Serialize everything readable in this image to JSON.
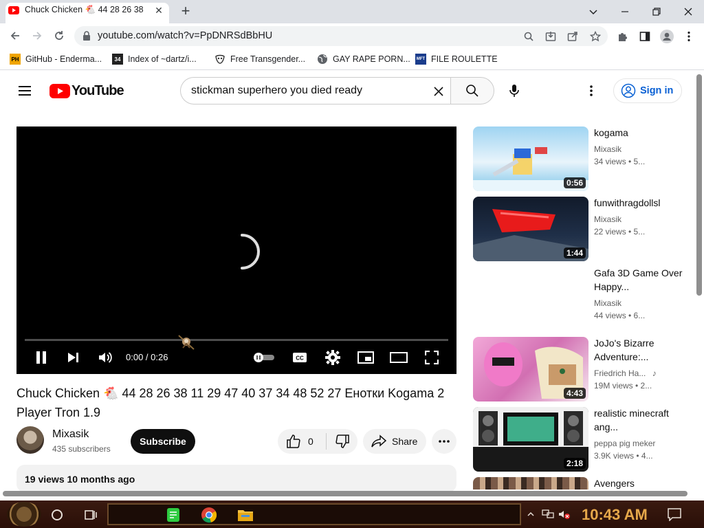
{
  "browser": {
    "tab_title": "Chuck Chicken 🐔 44 28 26 38",
    "url": "youtube.com/watch?v=PpDNRSdBbHU",
    "bookmarks": [
      {
        "label": "GitHub - Enderma...",
        "icon": "PH"
      },
      {
        "label": "Index of ~dartz/i...",
        "icon": "34"
      },
      {
        "label": "Free Transgender...",
        "icon": "mask"
      },
      {
        "label": "GAY RAPE PORN...",
        "icon": "globe"
      },
      {
        "label": "FILE ROULETTE",
        "icon": "MFT"
      }
    ]
  },
  "youtube": {
    "logo_text": "YouTube",
    "search_query": "stickman superhero you died ready",
    "signin_label": "Sign in"
  },
  "player": {
    "time": "0:00 / 0:26"
  },
  "video": {
    "title": "Chuck Chicken 🐔 44 28 26 38 11 29 47 40 37 34 48 52 27 Енотки Kogama 2 Player Tron 1.9",
    "channel": "Mixasik",
    "subscribers": "435 subscribers",
    "subscribe_label": "Subscribe",
    "likes": "0",
    "share_label": "Share",
    "views_date": "19 views  10 months ago"
  },
  "sidebar": [
    {
      "title": "kogama",
      "channel": "Mixasik",
      "meta": "34 views  • 5...",
      "duration": "0:56"
    },
    {
      "title": "funwithragdollsl",
      "channel": "Mixasik",
      "meta": "22 views  • 5...",
      "duration": "1:44"
    },
    {
      "title": "Gafa 3D Game Over Happy...",
      "channel": "Mixasik",
      "meta": "44 views  • 6...",
      "duration": ""
    },
    {
      "title": "JoJo's Bizarre Adventure:...",
      "channel": "Friedrich Ha...",
      "meta": "19M views  • 2...",
      "duration": "4:43"
    },
    {
      "title": "realistic minecraft ang...",
      "channel": "peppa pig meker",
      "meta": "3.9K views  • 4...",
      "duration": "2:18"
    },
    {
      "title": "Avengers",
      "channel": "",
      "meta": "",
      "duration": ""
    }
  ],
  "taskbar": {
    "clock": "10:43 AM"
  }
}
